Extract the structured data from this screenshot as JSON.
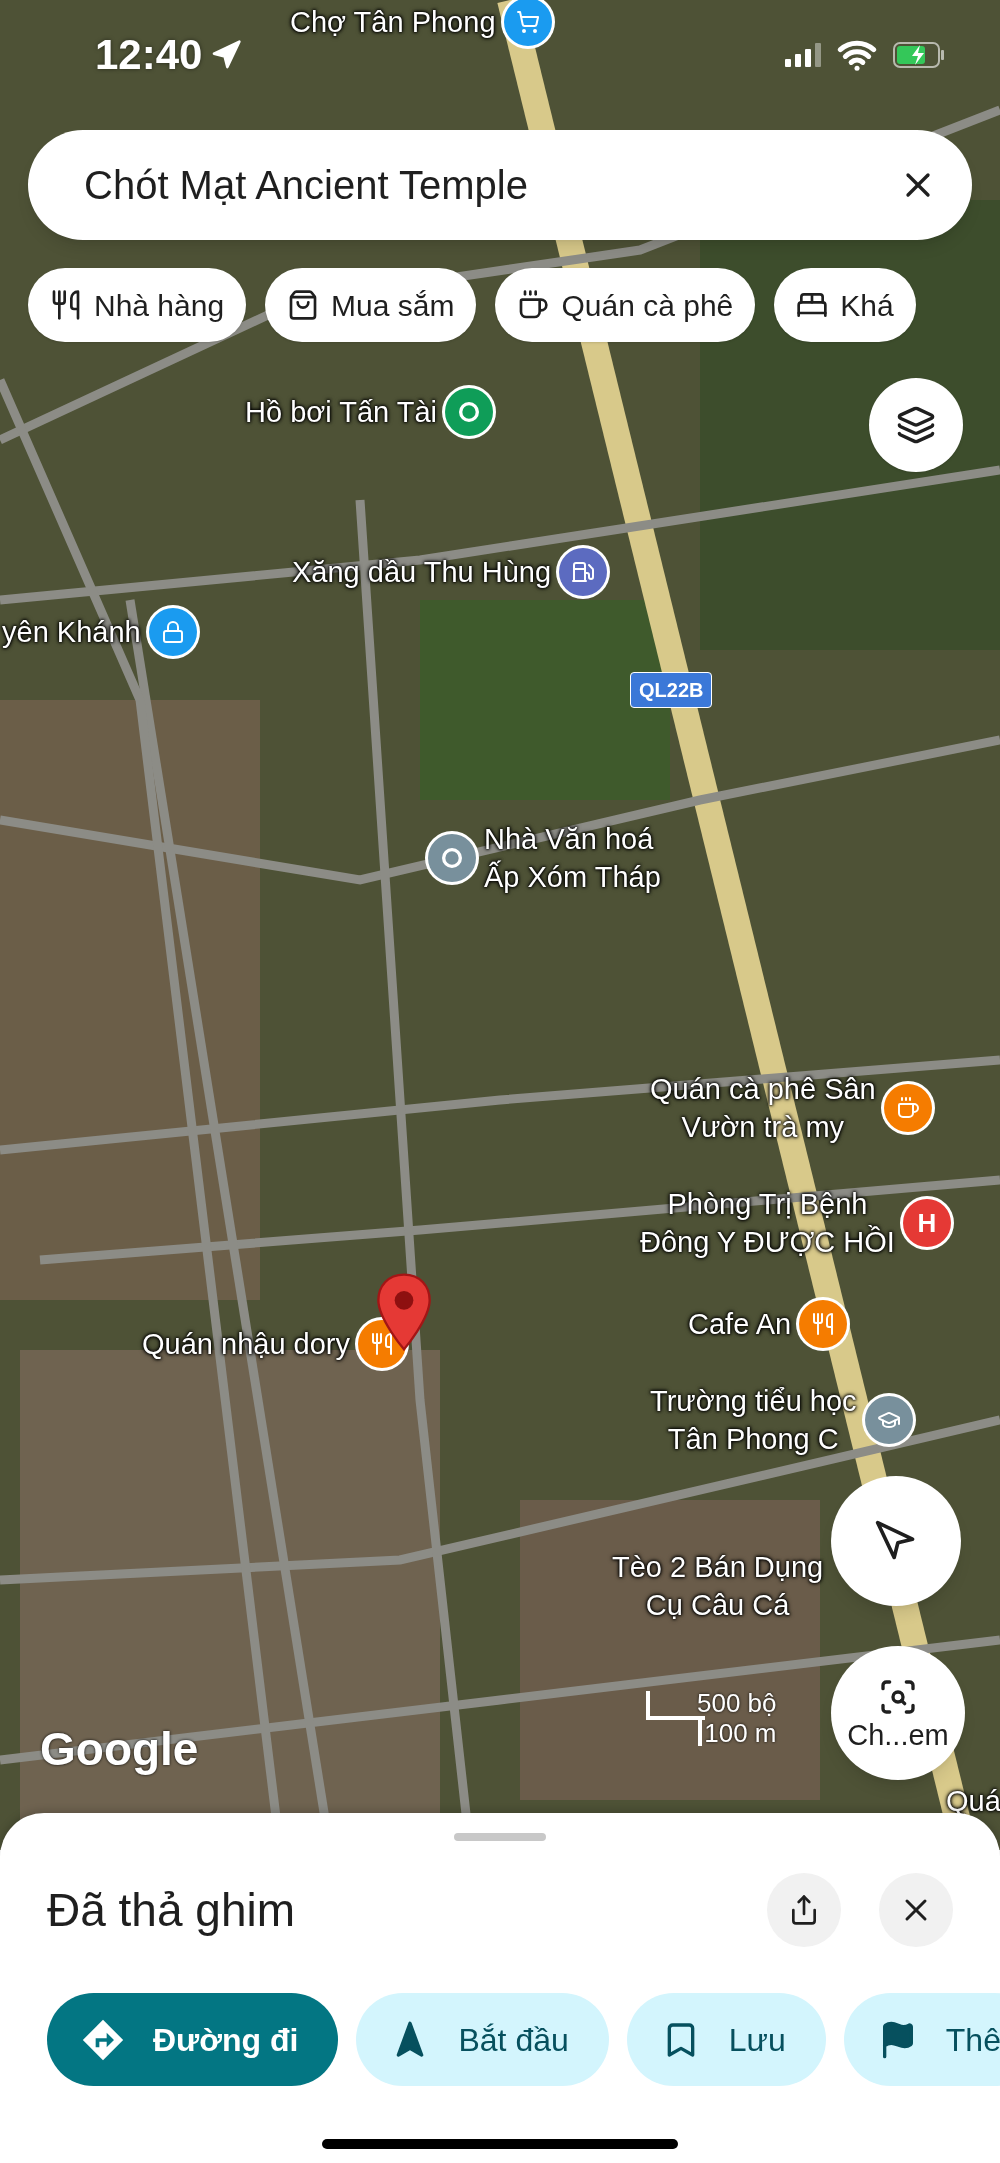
{
  "status_bar": {
    "time": "12:40"
  },
  "search": {
    "value": "Chót Mạt Ancient Temple"
  },
  "categories": [
    {
      "kind": "restaurant",
      "label": "Nhà hàng"
    },
    {
      "kind": "shopping",
      "label": "Mua sắm"
    },
    {
      "kind": "cafe",
      "label": "Quán cà phê"
    },
    {
      "kind": "hotel",
      "label": "Khá"
    }
  ],
  "map": {
    "pois": [
      {
        "kind": "shop",
        "color": "#1a9bf0",
        "lines": [
          "Chợ Tân Phong"
        ]
      },
      {
        "kind": "pool",
        "color": "#0f9d58",
        "lines": [
          "Hồ bơi Tấn Tài"
        ]
      },
      {
        "kind": "fuel",
        "color": "#5c6bc0",
        "lines": [
          "Xăng dầu Thu Hùng"
        ]
      },
      {
        "kind": "lock",
        "color": "#1a9bf0",
        "lines": [
          "yên Khánh"
        ]
      },
      {
        "kind": "landmark",
        "color": "#78909c",
        "lines": [
          "Nhà Văn hoá",
          "Ấp Xóm Tháp"
        ]
      },
      {
        "kind": "cafe",
        "color": "#f57c00",
        "lines": [
          "Quán cà phê Sân",
          "Vườn trà my"
        ]
      },
      {
        "kind": "hospital",
        "color": "#e53935",
        "glyph": "H",
        "lines": [
          "Phòng Trị Bệnh",
          "Đông Y ĐƯỢC HỒI"
        ]
      },
      {
        "kind": "restaurant",
        "color": "#f57c00",
        "lines": [
          "Cafe An"
        ]
      },
      {
        "kind": "school",
        "color": "#78909c",
        "lines": [
          "Trường tiểu học",
          "Tân Phong C"
        ]
      },
      {
        "kind": "restaurant",
        "color": "#f57c00",
        "lines": [
          "Quán nhậu dory"
        ]
      },
      {
        "kind": "none",
        "lines": [
          "Tèo 2 Bán Dụng",
          "Cụ Câu Cá"
        ]
      },
      {
        "kind": "none",
        "lines": [
          "Quá"
        ]
      }
    ],
    "road_shield": "QL22B",
    "logo": "Google",
    "scale": {
      "imperial": "500 bộ",
      "metric": "100 m"
    },
    "camera_button": "Ch...em"
  },
  "sheet": {
    "title": "Đã thả ghim",
    "actions": [
      {
        "kind": "directions",
        "label": "Đường đi",
        "selected": true
      },
      {
        "kind": "start",
        "label": "Bắt đầu",
        "selected": false
      },
      {
        "kind": "save",
        "label": "Lưu",
        "selected": false
      },
      {
        "kind": "flag",
        "label": "Thê",
        "selected": false
      }
    ]
  }
}
